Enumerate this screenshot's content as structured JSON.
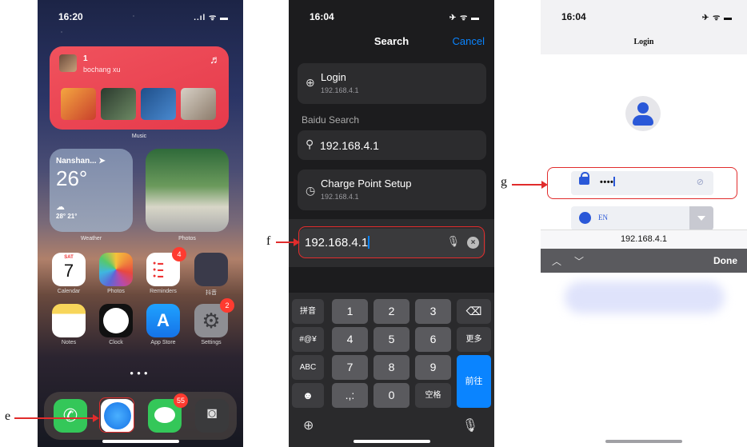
{
  "phone1": {
    "status": {
      "time": "16:20",
      "indicators": "..ıl ᯤ ▬"
    },
    "music_widget": {
      "count": "1",
      "artist": "bochang xu",
      "label": "Music"
    },
    "weather_widget": {
      "city": "Nanshan... ➤",
      "temp": "26°",
      "range": "28° 21°",
      "label": "Weather"
    },
    "photos_widget": {
      "label": "Photos"
    },
    "apps_row1": [
      {
        "label": "Calendar",
        "day": "7",
        "weekday": "SAT"
      },
      {
        "label": "Photos"
      },
      {
        "label": "Reminders",
        "badge": "4"
      },
      {
        "label": "抖音"
      }
    ],
    "apps_row2": [
      {
        "label": "Notes"
      },
      {
        "label": "Clock"
      },
      {
        "label": "App Store"
      },
      {
        "label": "Settings",
        "badge": "2"
      }
    ],
    "dock": {
      "messages_badge": "55"
    },
    "callout": "e"
  },
  "phone2": {
    "status": {
      "time": "16:04",
      "indicators": "✈ ᯤ ▬"
    },
    "title": "Search",
    "cancel": "Cancel",
    "result_login": {
      "title": "Login",
      "subtitle": "192.168.4.1"
    },
    "section": "Baidu Search",
    "result_search": {
      "title": "192.168.4.1"
    },
    "result_charge": {
      "title": "Charge Point Setup",
      "subtitle": "192.168.4.1"
    },
    "address_value": "192.168.4.1",
    "callout": "f",
    "keyboard": {
      "pinyin": "拼音",
      "symbols": "#@¥",
      "abc": "ABC",
      "emoji": "☻",
      "k1": "1",
      "k2": "2",
      "k3": "3",
      "k4": "4",
      "k5": "5",
      "k6": "6",
      "k7": "7",
      "k8": "8",
      "k9": "9",
      "k0": "0",
      "punct": ".,:",
      "space": "空格",
      "more": "更多",
      "go": "前往",
      "delete": "⌫"
    }
  },
  "phone3": {
    "status": {
      "time": "16:04",
      "indicators": "✈ ᯤ ▬"
    },
    "title": "Login",
    "password_mask": "••••",
    "lang_code": "EN",
    "url": "192.168.4.1",
    "done": "Done",
    "callout": "g"
  }
}
